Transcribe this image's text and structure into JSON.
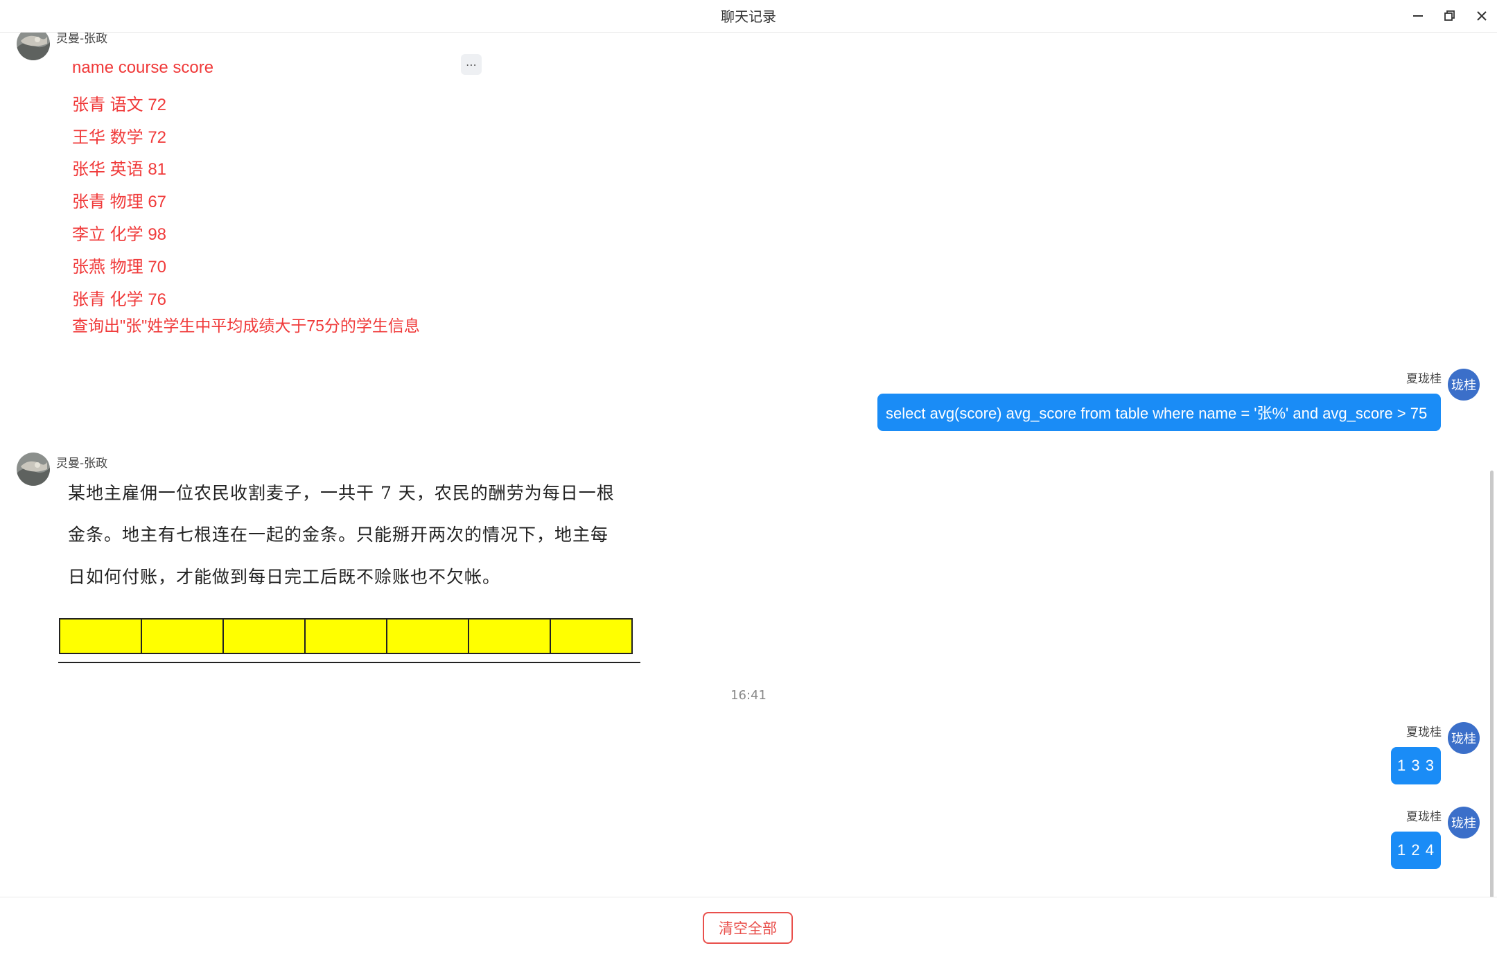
{
  "window": {
    "title": "聊天记录"
  },
  "messages": {
    "m1": {
      "sender": "灵曼-张政",
      "lines": [
        "name course score",
        "张青 语文 72",
        "王华 数学 72",
        "张华 英语 81",
        "张青 物理 67",
        "李立 化学 98",
        "张燕 物理 70",
        "张青 化学 76"
      ],
      "question": "查询出\"张\"姓学生中平均成绩大于75分的学生信息",
      "more_label": "⋯"
    },
    "m2": {
      "sender": "夏珑桂",
      "avatar_text": "珑桂",
      "text": "select avg(score) avg_score from table where name = '张%' and avg_score > 75"
    },
    "m3": {
      "sender": "灵曼-张政",
      "lines": [
        "某地主雇佣一位农民收割麦子，一共干 7 天，农民的酬劳为每日一根",
        "金条。地主有七根连在一起的金条。只能掰开两次的情况下，地主每",
        "日如何付账，才能做到每日完工后既不赊账也不欠帐。"
      ],
      "gold_bar_count": 7
    },
    "timestamp": "16:41",
    "m4": {
      "sender": "夏珑桂",
      "avatar_text": "珑桂",
      "text": "1 3 3"
    },
    "m5": {
      "sender": "夏珑桂",
      "avatar_text": "珑桂",
      "text": "1 2 4"
    }
  },
  "footer": {
    "clear_label": "清空全部"
  },
  "colors": {
    "accent": "#1a8cf6",
    "red_text": "#f03a3a",
    "gold": "#ffff00",
    "avatar": "#3b6fc9",
    "danger": "#e9504c"
  }
}
